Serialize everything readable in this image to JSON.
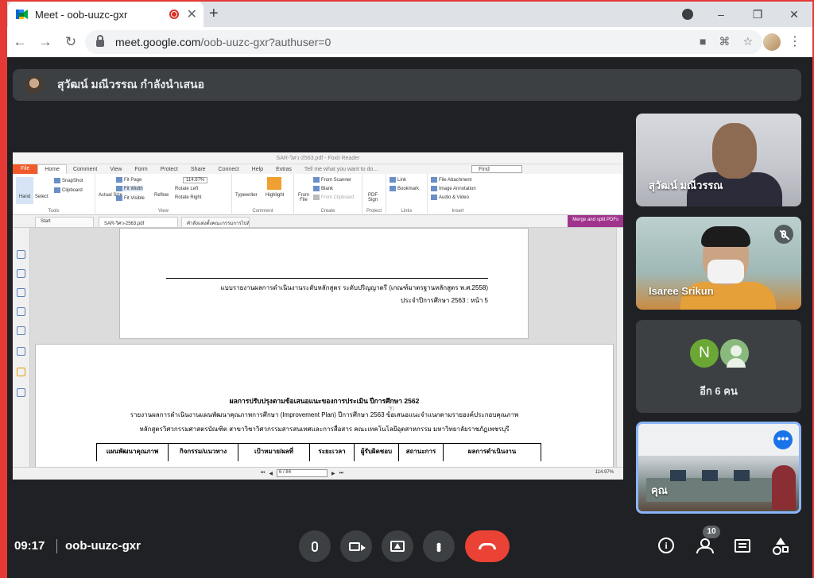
{
  "browser": {
    "tab_title": "Meet - oob-uuzc-gxr",
    "url_host": "meet.google.com",
    "url_path": "/oob-uuzc-gxr?authuser=0",
    "controls": {
      "minimize": "–",
      "restore": "❐",
      "close": "✕",
      "new_tab": "+",
      "tab_close": "✕"
    }
  },
  "meet": {
    "presenting_banner": "สุวัฒน์ มณีวรรณ กำลังนำเสนอ",
    "time": "09:17",
    "meeting_code": "oob-uuzc-gxr",
    "participant_count": "10",
    "colors": {
      "accent": "#1a73e8",
      "hangup": "#ea4335",
      "surface": "#3c4043",
      "background": "#202124"
    }
  },
  "participants": [
    {
      "name": "สุวัฒน์ มณีวรรณ"
    },
    {
      "name": "Isaree Srikun"
    },
    {
      "initial": "N",
      "others_label": "อีก 6 คน"
    },
    {
      "name": "คุณ"
    }
  ],
  "shared_screen": {
    "app_title": "SAR-วิศว-2563.pdf - Foxit Reader",
    "menu": [
      "File",
      "Home",
      "Comment",
      "View",
      "Form",
      "Protect",
      "Share",
      "Connect",
      "Help",
      "Extras"
    ],
    "tell_me": "Tell me what you want to do...",
    "find": "Find",
    "ribbon": {
      "hand": "Hand",
      "select": "Select",
      "snapshot": "SnapShot",
      "clipboard": "Clipboard",
      "actual_size": "Actual Size",
      "fit_page": "Fit Page",
      "fit_width": "Fit Width",
      "fit_visible": "Fit Visible",
      "zoom": "114.97%",
      "reflow": "Reflow",
      "rotate_left": "Rotate Left",
      "rotate_right": "Rotate Right",
      "typewriter": "Typewriter",
      "highlight": "Highlight",
      "from_file": "From File",
      "from_scanner": "From Scanner",
      "blank": "Blank",
      "from_clipboard": "From Clipboard",
      "pdf_sign": "PDF Sign",
      "link": "Link",
      "bookmark": "Bookmark",
      "file_attachment": "File Attachment",
      "image_annotation": "Image Annotation",
      "audio_video": "Audio & Video",
      "groups": [
        "Tools",
        "View",
        "Comment",
        "Create",
        "Protect",
        "Links",
        "Insert"
      ]
    },
    "doc_tabs": [
      "Start",
      "SAR-วิศว-2563.pdf",
      "คำสั่งแต่งตั้งคณะกรรมการไปสัมม..."
    ],
    "merge_button": "Merge and split PDFs",
    "page1_line1": "แบบรายงานผลการดำเนินงานระดับหลักสูตร ระดับปริญญาตรี (เกณฑ์มาตรฐานหลักสูตร พ.ศ.2558)",
    "page1_line2": "ประจำปีการศึกษา 2563 : หน้า 5",
    "page2_heading": "ผลการปรับปรุงตามข้อเสนอแนะของการประเมิน ปีการศึกษา 2562",
    "page2_line1": "รายงานผลการดำเนินงานแผนพัฒนาคุณภาพการศึกษา (Improvement Plan) ปีการศึกษา 2563 ข้อเสนอแนะจำแนกตามรายองค์ประกอบคุณภาพ",
    "page2_line2": "หลักสูตรวิศวกรรมศาสตรบัณฑิต สาขาวิชาวิศวกรรมสารสนเทศและการสื่อสาร คณะเทคโนโลยีอุตสาหกรรม มหาวิทยาลัยราชภัฏเพชรบุรี",
    "table_headers": [
      "แผนพัฒนาคุณภาพ",
      "กิจกรรม/แนวทาง",
      "เป้าหมาย/ผลที่",
      "ระยะเวลา",
      "ผู้รับผิดชอบ",
      "สถานะการ",
      "ผลการดำเนินงาน"
    ],
    "page_indicator": "6 / 84",
    "status_zoom": "114.97%"
  }
}
